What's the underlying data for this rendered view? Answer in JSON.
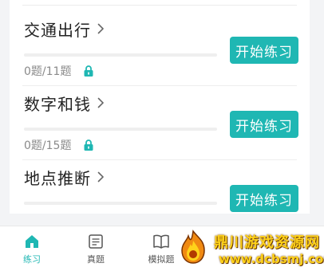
{
  "colors": {
    "accent": "#1fb7b3",
    "lock": "#1fb7b3"
  },
  "items": [
    {
      "title": "交通出行",
      "count": "0题/11题",
      "progress": 0,
      "button": "开始练习",
      "locked": true
    },
    {
      "title": "数字和钱",
      "count": "0题/15题",
      "progress": 0,
      "button": "开始练习",
      "locked": true
    },
    {
      "title": "地点推断",
      "button": "开始练习"
    }
  ],
  "nav": {
    "tabs": [
      {
        "label": "练习",
        "icon": "home-icon",
        "active": true
      },
      {
        "label": "真题",
        "icon": "exam-paper-icon"
      },
      {
        "label": "模拟题",
        "icon": "book-icon"
      }
    ]
  },
  "watermark": {
    "name": "鼎川游戏资源网",
    "url": "www.dcbsmj.com"
  }
}
